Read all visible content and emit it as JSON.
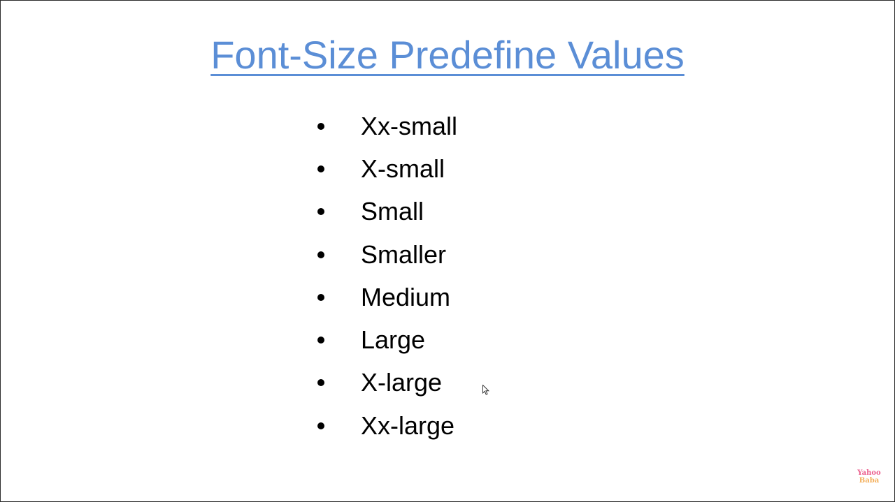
{
  "slide": {
    "title": "Font-Size Predefine Values",
    "title_color": "#5b8ed6",
    "bullet_items": [
      {
        "label": "Xx-small"
      },
      {
        "label": "X-small"
      },
      {
        "label": "Small"
      },
      {
        "label": "Smaller"
      },
      {
        "label": "Medium"
      },
      {
        "label": "Large"
      },
      {
        "label": "X-large"
      },
      {
        "label": "Xx-large"
      }
    ]
  },
  "watermark": {
    "line1": "Yahoo",
    "line2": "Baba",
    "color_line1": "#e8437a",
    "color_line2": "#f2a03c"
  },
  "icons": {
    "cursor": "mouse-pointer-icon"
  }
}
